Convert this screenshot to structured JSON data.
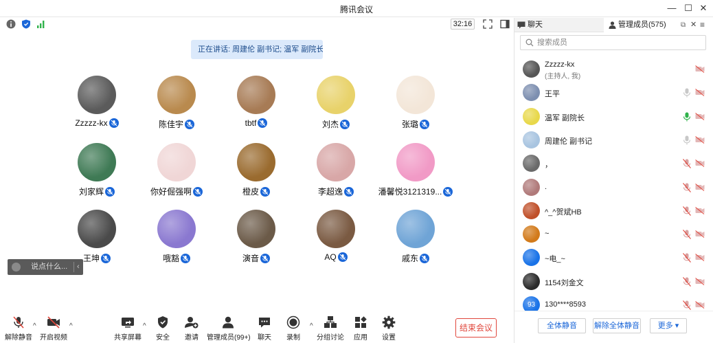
{
  "window": {
    "title": "腾讯会议"
  },
  "meeting": {
    "timer": "32:16",
    "speaking": "正在讲话: 周建伦 副书记; 温军 副院长;..."
  },
  "participants": [
    {
      "name": "Zzzzz-kx",
      "avatar_color": "#5b5b5b"
    },
    {
      "name": "陈佳宇",
      "avatar_color": "#b98a4e"
    },
    {
      "name": "tbtf",
      "avatar_color": "#a77b55"
    },
    {
      "name": "刘杰",
      "avatar_color": "#e8d26a"
    },
    {
      "name": "张璐",
      "avatar_color": "#f3e6d8"
    },
    {
      "name": "刘家辉",
      "avatar_color": "#3f7a55"
    },
    {
      "name": "你好倔强啊",
      "avatar_color": "#f0d6d6"
    },
    {
      "name": "橙皮",
      "avatar_color": "#9a6b2f"
    },
    {
      "name": "李超逸",
      "avatar_color": "#d8a7a7"
    },
    {
      "name": "潘馨悦3121319...",
      "avatar_color": "#f19ac6"
    },
    {
      "name": "王坤",
      "avatar_color": "#4a4a4a"
    },
    {
      "name": "哦豁",
      "avatar_color": "#8a78d0"
    },
    {
      "name": "演音",
      "avatar_color": "#6b5a48"
    },
    {
      "name": "AQ",
      "avatar_color": "#7a5a42"
    },
    {
      "name": "戚东",
      "avatar_color": "#6fa4d6"
    }
  ],
  "chat_input": {
    "placeholder": "说点什么..."
  },
  "toolbar": {
    "unmute": "解除静音",
    "video": "开启视频",
    "share": "共享屏幕",
    "security": "安全",
    "invite": "邀请",
    "members": "管理成员(99+)",
    "chat": "聊天",
    "record": "录制",
    "breakout": "分组讨论",
    "apps": "应用",
    "settings": "设置",
    "end": "结束会议"
  },
  "panel": {
    "tab_chat": "聊天",
    "tab_members": "管理成员(575)",
    "search_placeholder": "搜索成员",
    "members": [
      {
        "name": "Zzzzz-kx",
        "sub": "(主持人, 我)",
        "avatar_color": "#555555",
        "mic": "muted"
      },
      {
        "name": "王平",
        "sub": "",
        "avatar_color": "#7d8fb0",
        "mic": "off"
      },
      {
        "name": "温军 副院长",
        "sub": "",
        "avatar_color": "#e8d84a",
        "mic": "active"
      },
      {
        "name": "周建伦 副书记",
        "sub": "",
        "avatar_color": "#a8c4e0",
        "mic": "off"
      },
      {
        "name": "，",
        "sub": "",
        "avatar_color": "#6a6a6a",
        "mic": "muted"
      },
      {
        "name": ".",
        "sub": "",
        "avatar_color": "#b07a7a",
        "mic": "muted"
      },
      {
        "name": "^_^贺斌HB",
        "sub": "",
        "avatar_color": "#c0502a",
        "mic": "muted"
      },
      {
        "name": "~",
        "sub": "",
        "avatar_color": "#d27a1a",
        "mic": "muted"
      },
      {
        "name": "~电_~",
        "sub": "",
        "avatar_color": "#1a73e8",
        "mic": "muted"
      },
      {
        "name": "1154刘金文",
        "sub": "",
        "avatar_color": "#2b2b2b",
        "mic": "muted"
      },
      {
        "name": "130****8593",
        "sub": "",
        "avatar_color": "#1a73e8",
        "avatar_text": "93",
        "mic": "muted"
      }
    ],
    "mute_all": "全体静音",
    "unmute_all": "解除全体静音",
    "more": "更多"
  },
  "colors": {
    "accent": "#1a66d8",
    "danger": "#e0463b",
    "mic_active": "#2fb24a"
  }
}
